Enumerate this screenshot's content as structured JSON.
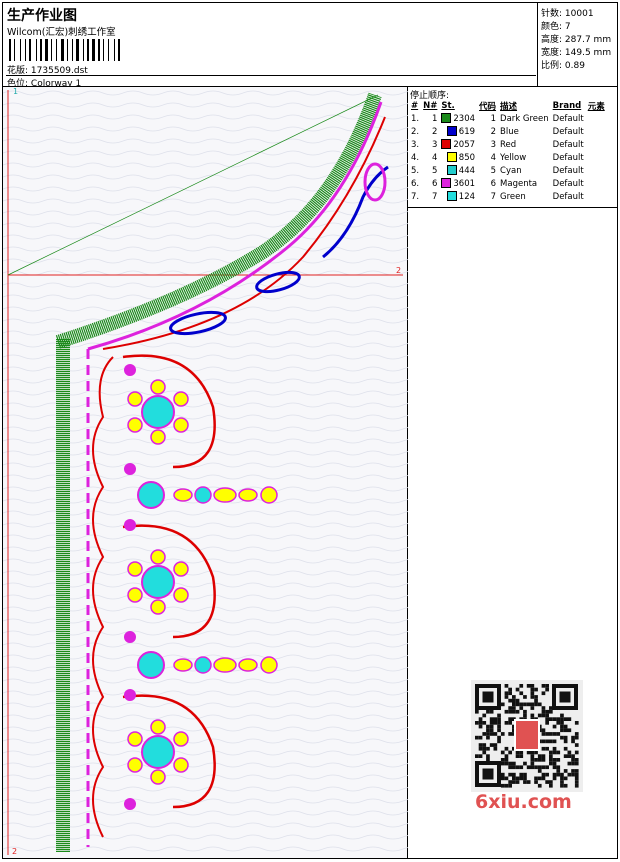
{
  "header": {
    "title": "生产作业图",
    "company": "Wilcom(汇宏)刺绣工作室",
    "design_label": "花版:",
    "design_file": "1735509.dst",
    "colorway_label": "色位:",
    "colorway": "Colorway 1"
  },
  "stats": {
    "stitches_label": "针数:",
    "stitches": "10001",
    "colors_label": "颜色:",
    "colors": "7",
    "height_label": "高度:",
    "height": "287.7 mm",
    "width_label": "宽度:",
    "width": "149.5 mm",
    "scale_label": "比例:",
    "scale": "0.89"
  },
  "stop_sequence": {
    "title": "停止顺序:",
    "columns": [
      "#",
      "N#",
      "St.",
      "代码",
      "描述",
      "Brand",
      "元素"
    ],
    "rows": [
      {
        "idx": "1.",
        "n": "1",
        "color": "#1a8a1a",
        "st": "2304",
        "code": "1",
        "desc": "Dark Green",
        "brand": "Default"
      },
      {
        "idx": "2.",
        "n": "2",
        "color": "#0000cc",
        "st": "619",
        "code": "2",
        "desc": "Blue",
        "brand": "Default"
      },
      {
        "idx": "3.",
        "n": "3",
        "color": "#dd0000",
        "st": "2057",
        "code": "3",
        "desc": "Red",
        "brand": "Default"
      },
      {
        "idx": "4.",
        "n": "4",
        "color": "#ffff00",
        "st": "850",
        "code": "4",
        "desc": "Yellow",
        "brand": "Default"
      },
      {
        "idx": "5.",
        "n": "5",
        "color": "#22cccc",
        "st": "444",
        "code": "5",
        "desc": "Cyan",
        "brand": "Default"
      },
      {
        "idx": "6.",
        "n": "6",
        "color": "#dd22dd",
        "st": "3601",
        "code": "6",
        "desc": "Magenta",
        "brand": "Default"
      },
      {
        "idx": "7.",
        "n": "7",
        "color": "#22dddd",
        "st": "124",
        "code": "7",
        "desc": "Green",
        "brand": "Default"
      }
    ]
  },
  "canvas": {
    "axis_markers": [
      "1",
      "2",
      "2"
    ]
  },
  "watermark": "6xiu.com"
}
